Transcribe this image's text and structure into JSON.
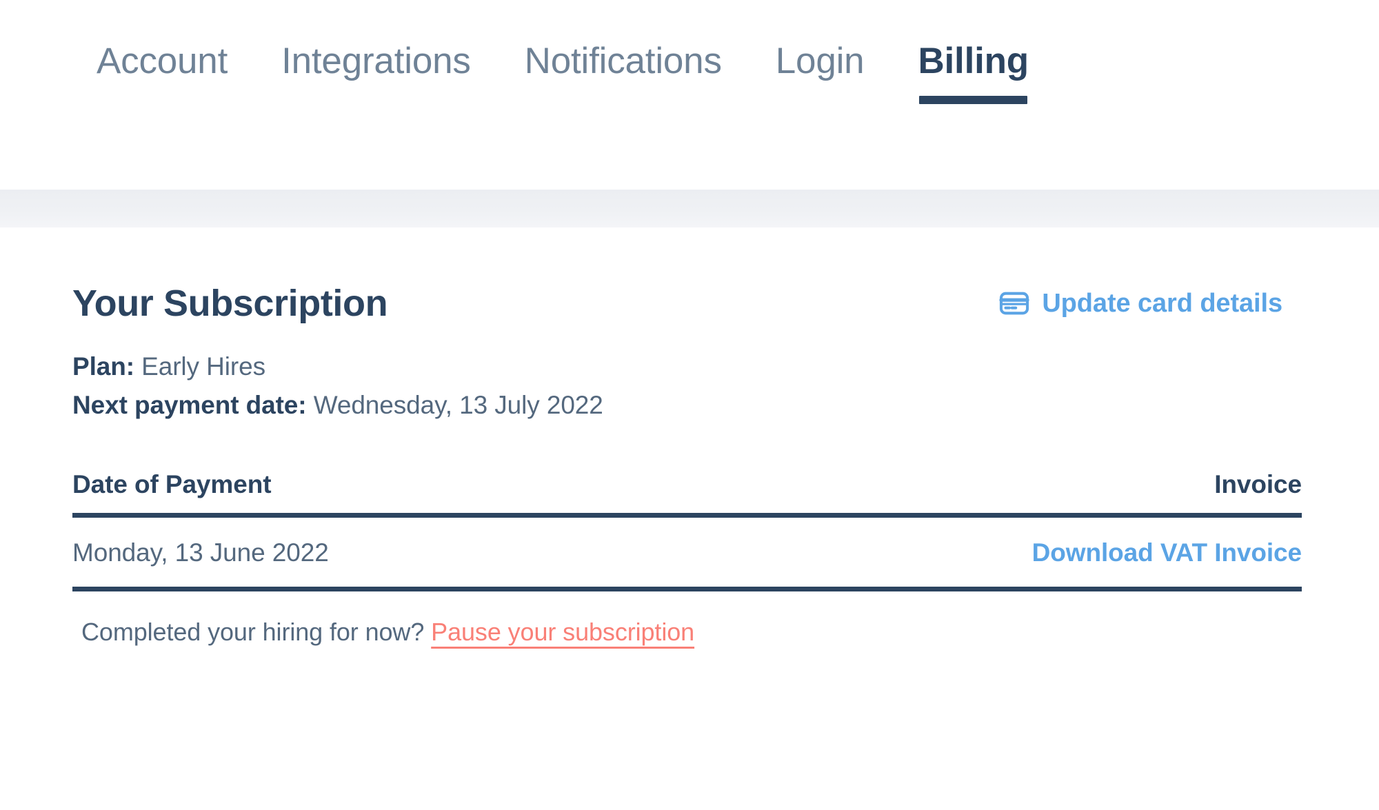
{
  "nav": {
    "tabs": [
      {
        "label": "Account",
        "active": false
      },
      {
        "label": "Integrations",
        "active": false
      },
      {
        "label": "Notifications",
        "active": false
      },
      {
        "label": "Login",
        "active": false
      },
      {
        "label": "Billing",
        "active": true
      }
    ]
  },
  "subscription": {
    "title": "Your Subscription",
    "update_card_label": "Update card details",
    "update_card_icon": "credit-card-icon",
    "plan_label": "Plan:",
    "plan_value": "Early Hires",
    "next_payment_label": "Next payment date:",
    "next_payment_value": "Wednesday, 13 July 2022"
  },
  "invoices": {
    "columns": {
      "date": "Date of Payment",
      "invoice": "Invoice"
    },
    "rows": [
      {
        "date": "Monday, 13 June 2022",
        "invoice_link": "Download VAT Invoice"
      }
    ]
  },
  "footer": {
    "prompt": "Completed your hiring for now?",
    "pause_link": "Pause your subscription"
  },
  "colors": {
    "navy": "#2c4460",
    "body_text": "#54687e",
    "muted_tab": "#6f8296",
    "link_blue": "#5ba4e5",
    "pause_red": "#f98077",
    "band_grey": "#eef0f3"
  }
}
